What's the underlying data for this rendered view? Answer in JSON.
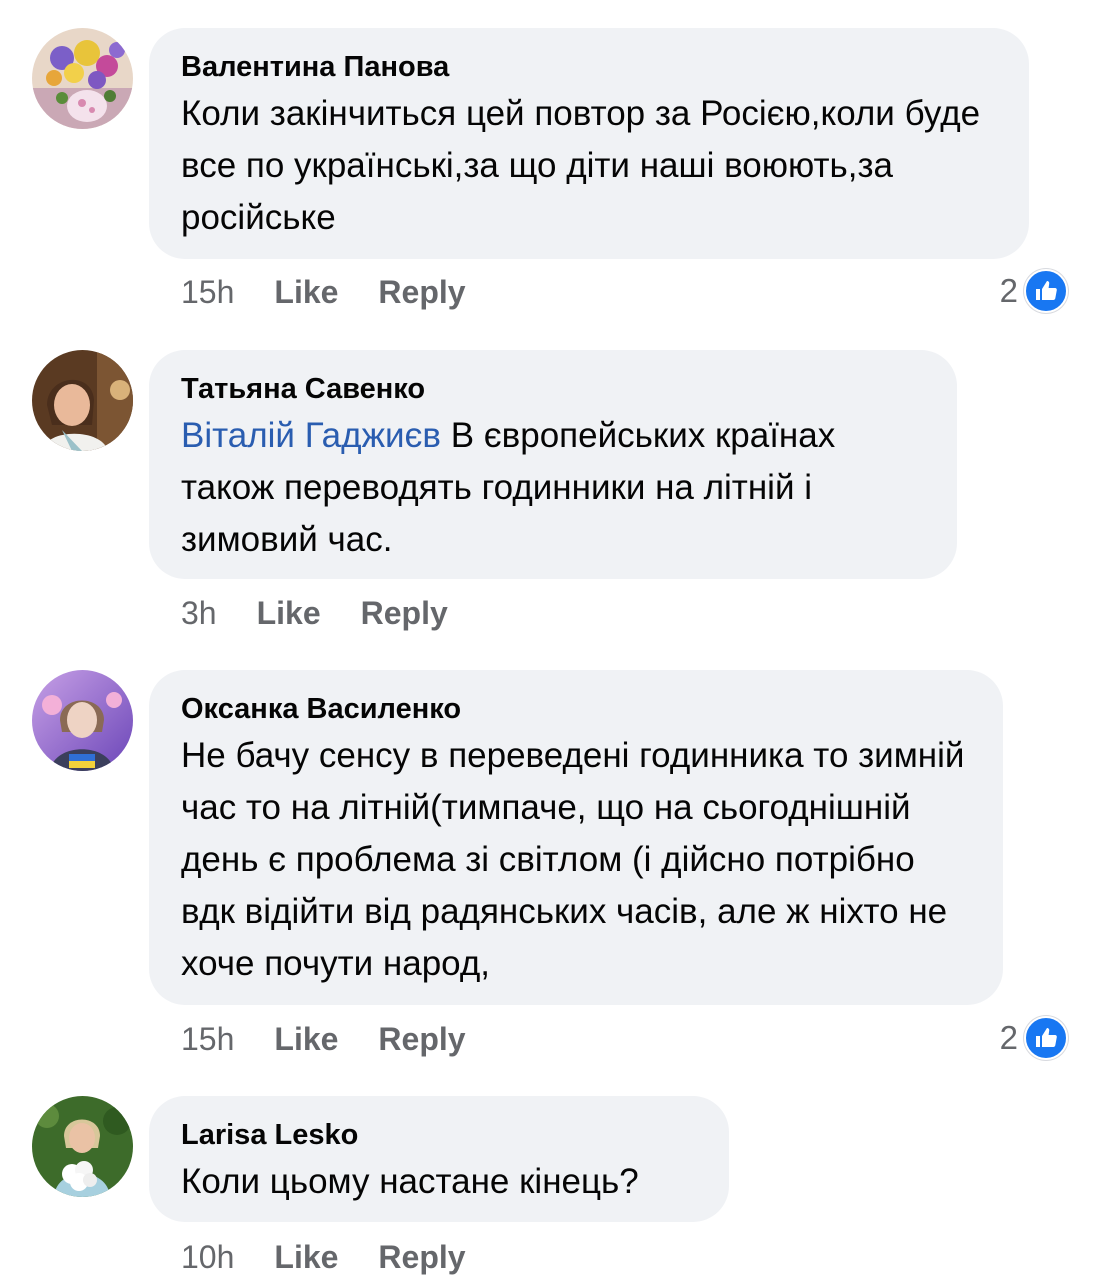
{
  "comments": [
    {
      "author": "Валентина Панова",
      "mention": "",
      "text": "Коли закінчиться цей повтор за Росією,коли буде все по українські,за що діти наші воюють,за російське",
      "time": "15h",
      "like_label": "Like",
      "reply_label": "Reply",
      "reaction_count": "2",
      "reaction_icon": "thumbs-up-icon",
      "avatar": "flowers-avatar"
    },
    {
      "author": "Татьяна Савенко",
      "mention": "Віталій Гаджиєв",
      "text": " В європейських країнах також переводять годинники на літній і зимовий час.",
      "time": "3h",
      "like_label": "Like",
      "reply_label": "Reply",
      "avatar": "woman-avatar"
    },
    {
      "author": "Оксанка Василенко",
      "mention": "",
      "text": "Не бачу сенсу в переведені годинника то зимній час то на літній(тимпаче, що на сьогоднішній день є проблема зі світлом (і дійсно потрібно вдк відійти від радянських часів, але ж ніхто не хоче почути народ,",
      "time": "15h",
      "like_label": "Like",
      "reply_label": "Reply",
      "reaction_count": "2",
      "reaction_icon": "thumbs-up-icon",
      "avatar": "woman-ukraine-flag-avatar"
    },
    {
      "author": "Larisa Lesko",
      "mention": "",
      "text": "Коли цьому настане кінець?",
      "time": "10h",
      "like_label": "Like",
      "reply_label": "Reply",
      "avatar": "woman-flowers-avatar"
    }
  ],
  "colors": {
    "bubble": "#f0f2f5",
    "mention": "#2a5db0",
    "meta": "#65676b",
    "like_badge": "#1877f2"
  }
}
